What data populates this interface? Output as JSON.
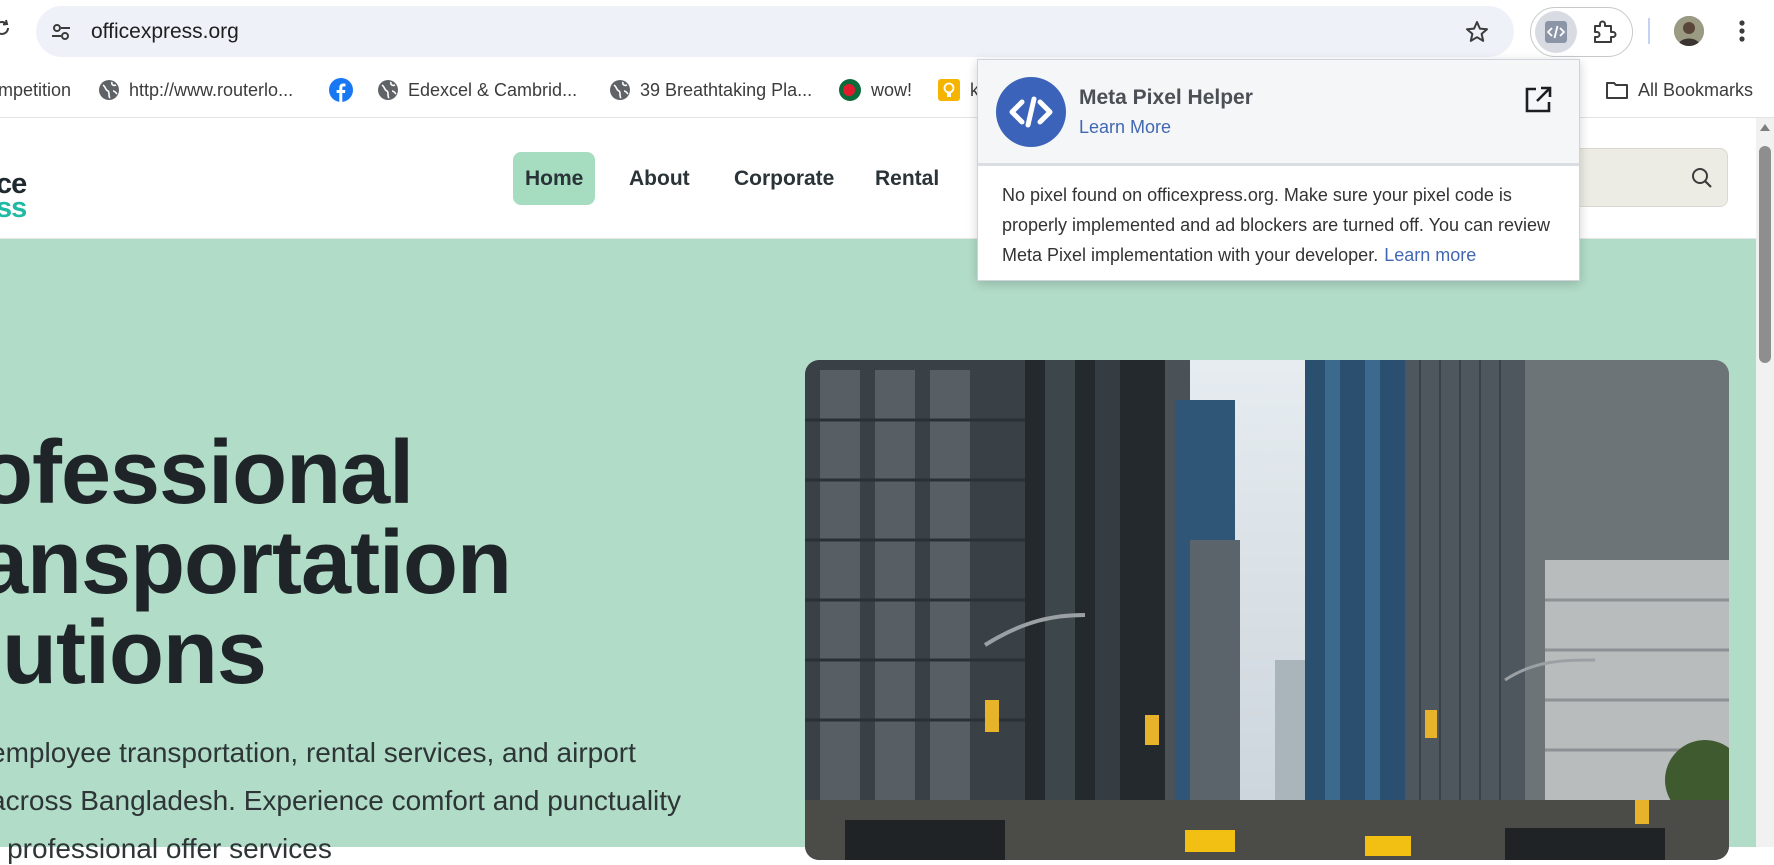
{
  "browser": {
    "url": "officexpress.org",
    "colors": {
      "omnibox": "#eef1f8",
      "accent": "#4267b2"
    }
  },
  "bookmarks": {
    "items": [
      {
        "label": "mpetition",
        "icon": "none"
      },
      {
        "label": "http://www.routerlo...",
        "icon": "globe-icon"
      },
      {
        "label": "",
        "icon": "facebook-icon"
      },
      {
        "label": "Edexcel & Cambrid...",
        "icon": "globe-icon"
      },
      {
        "label": "39 Breathtaking Pla...",
        "icon": "globe-icon"
      },
      {
        "label": "wow!",
        "icon": "bangladesh-flag-icon"
      },
      {
        "label": "k",
        "icon": "bulb-icon"
      }
    ],
    "all_bookmarks": "All Bookmarks"
  },
  "site": {
    "logo_top": "ce",
    "logo_bottom": "ss",
    "nav": [
      "Home",
      "About",
      "Corporate",
      "Rental"
    ],
    "active_nav": "Home",
    "hero": {
      "title_lines": [
        "ofessional",
        "ansportation",
        "lutions"
      ],
      "desc_lines": [
        "employee transportation, rental services, and airport",
        "across Bangladesh. Experience comfort and punctuality",
        "r professional    offer services"
      ]
    },
    "colors": {
      "hero_bg": "#b1dcc8",
      "nav_active_bg": "#a6dcc0",
      "logo_accent": "#1fb9a4"
    }
  },
  "popup": {
    "title": "Meta Pixel Helper",
    "learn_more": "Learn More",
    "message": "No pixel found on officexpress.org. Make sure your pixel code is properly implemented and ad blockers are turned off. You can review Meta Pixel implementation with your developer.",
    "learn_more_inline": "Learn more"
  }
}
